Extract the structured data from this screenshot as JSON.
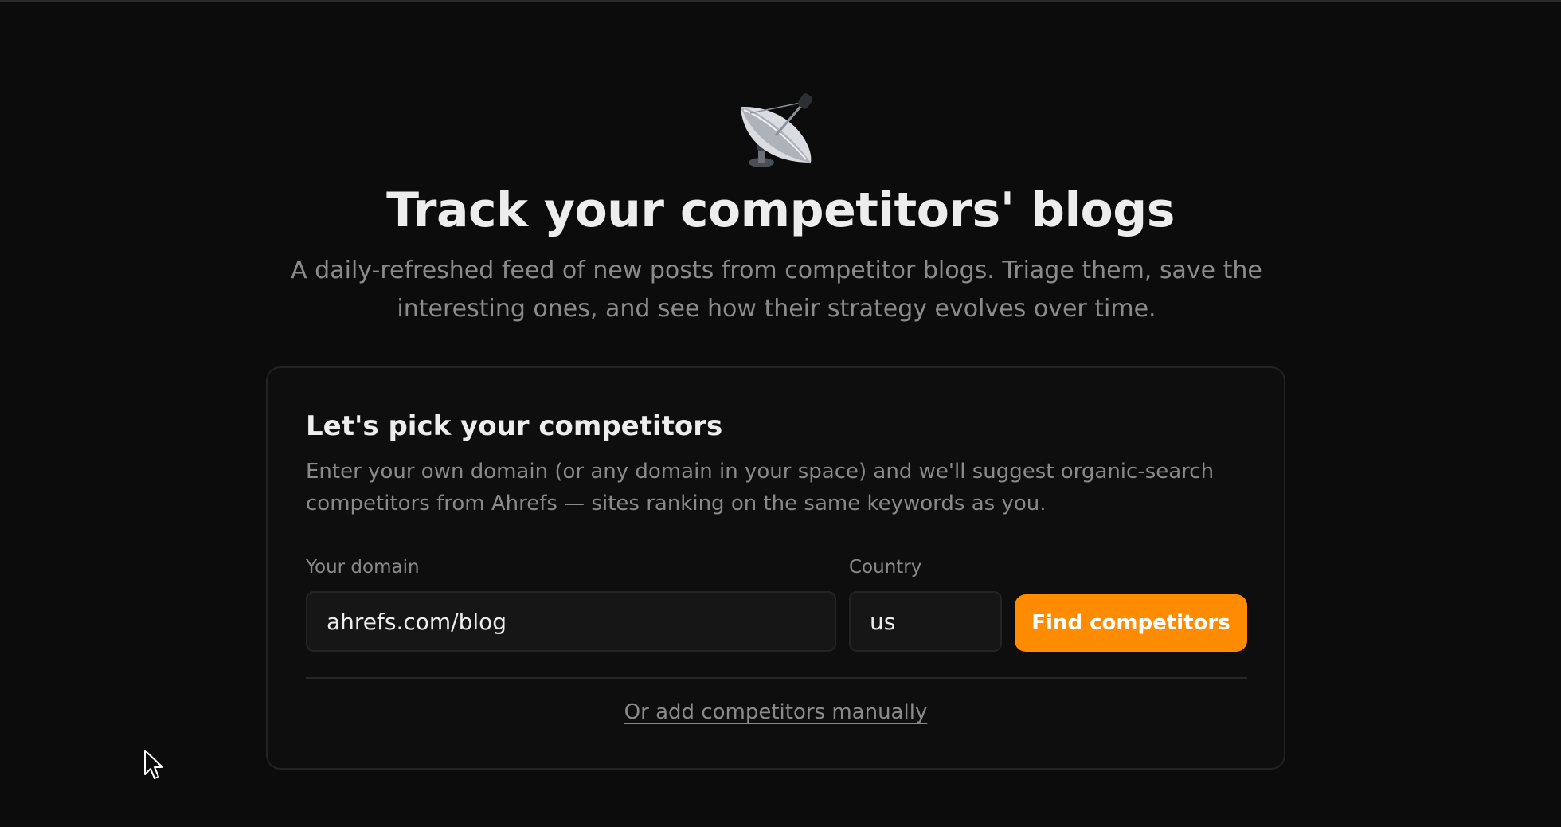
{
  "hero": {
    "icon": "satellite-dish-icon",
    "title": "Track your competitors' blogs",
    "subtitle": "A daily-refreshed feed of new posts from competitor blogs. Triage them, save the interesting ones, and see how their strategy evolves over time."
  },
  "card": {
    "title": "Let's pick your competitors",
    "description": "Enter your own domain (or any domain in your space) and we'll suggest organic-search competitors from Ahrefs — sites ranking on the same keywords as you.",
    "domain_label": "Your domain",
    "domain_value": "ahrefs.com/blog",
    "country_label": "Country",
    "country_value": "us",
    "find_button_label": "Find competitors",
    "manual_link_label": "Or add competitors manually"
  },
  "colors": {
    "background": "#0c0c0c",
    "accent": "#ff8c00",
    "text_primary": "#ededed",
    "text_muted": "#8a8a8a"
  }
}
